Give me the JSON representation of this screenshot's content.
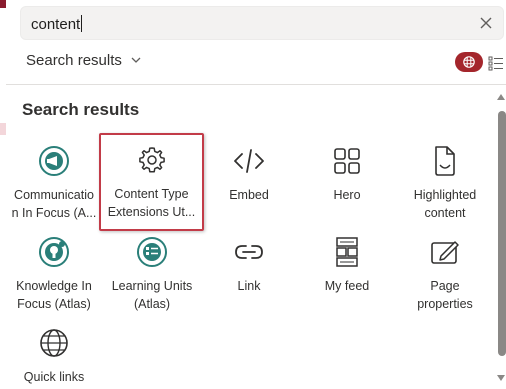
{
  "search": {
    "query": "content"
  },
  "filter": {
    "label": "Search results"
  },
  "section": {
    "title": "Search results"
  },
  "colors": {
    "accent": "#a4262c",
    "teal": "#2a7f79",
    "highlight_border": "#c23b48"
  },
  "tiles": [
    {
      "label": "Communicatio\nn In Focus (A...",
      "icon": "megaphone-icon"
    },
    {
      "label": "Content Type\nExtensions Ut...",
      "icon": "gear-icon"
    },
    {
      "label": "Embed",
      "icon": "code-icon"
    },
    {
      "label": "Hero",
      "icon": "hero-grid-icon"
    },
    {
      "label": "Highlighted\ncontent",
      "icon": "document-icon"
    },
    {
      "label": "Knowledge In\nFocus (Atlas)",
      "icon": "knowledge-icon"
    },
    {
      "label": "Learning Units\n(Atlas)",
      "icon": "learning-list-icon"
    },
    {
      "label": "Link",
      "icon": "link-icon"
    },
    {
      "label": "My feed",
      "icon": "feed-icon"
    },
    {
      "label": "Page\nproperties",
      "icon": "page-properties-icon"
    },
    {
      "label": "Quick links",
      "icon": "globe-icon"
    }
  ]
}
